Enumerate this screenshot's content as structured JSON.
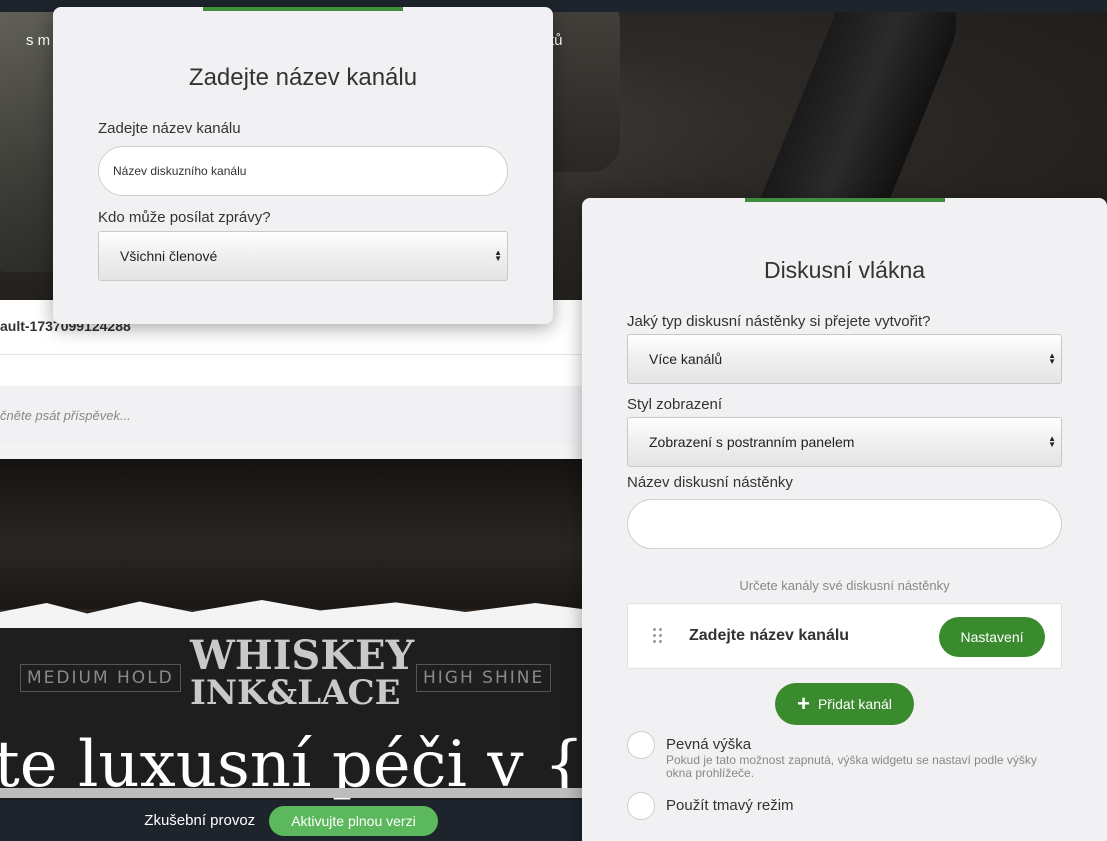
{
  "background": {
    "hero_text_left": "s m",
    "hero_text_right": "tů",
    "post_title": "ault-1737099124288",
    "post_placeholder": "čněte psát příspěvek...",
    "tag_left": "MEDIUM HOLD",
    "tag_right": "HIGH SHINE",
    "brand_line1": "WHISKEY",
    "brand_line2": "INK&LACE",
    "headline": "te luxusní péči v {in"
  },
  "trial_bar": {
    "label": "Zkušební provoz",
    "activate_button": "Aktivujte plnou verzi"
  },
  "channel_modal": {
    "title": "Zadejte název kanálu",
    "name_label": "Zadejte název kanálu",
    "name_value": "Název diskuzního kanálu",
    "who_label": "Kdo může posílat zprávy?",
    "who_value": "Všichni členové"
  },
  "threads_modal": {
    "title": "Diskusní vlákna",
    "type_label": "Jaký typ diskusní nástěnky si přejete vytvořit?",
    "type_value": "Více kanálů",
    "style_label": "Styl zobrazení",
    "style_value": "Zobrazení s postranním panelem",
    "board_name_label": "Název diskusní nástěnky",
    "board_name_value": "",
    "channels_hint": "Určete kanály své diskusní nástěnky",
    "channel_name": "Zadejte název kanálu",
    "settings_button": "Nastavení",
    "add_channel_button": "Přidat kanál",
    "fixed_height_label": "Pevná výška",
    "fixed_height_hint": "Pokud je tato možnost zapnutá, výška widgetu se nastaví podle výšky okna prohlížeče.",
    "dark_mode_label": "Použít tmavý režim"
  },
  "colors": {
    "accent_green": "#3a8a2e",
    "trial_button": "#5cb85c",
    "modal_bg": "#f1f1f4"
  }
}
